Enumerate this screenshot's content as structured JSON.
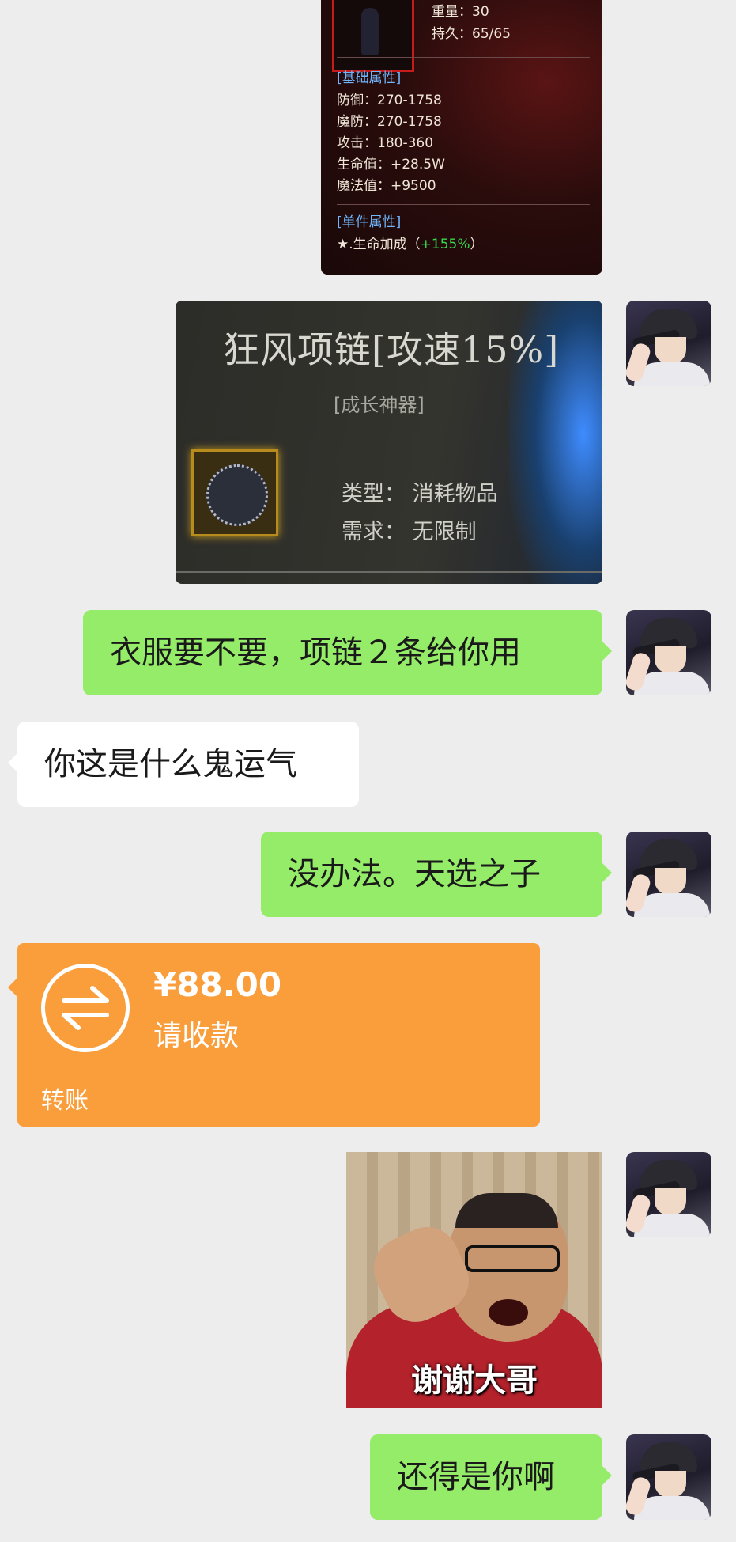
{
  "card1": {
    "weight": "重量：30",
    "durability": "持久：65/65",
    "base_title": "[基础属性]",
    "defense": "防御：270-1758",
    "magic_defense": "魔防：270-1758",
    "attack": "攻击：180-360",
    "hp": "生命值：+28.5W",
    "mp": "魔法值：+9500",
    "single_title": "[单件属性]",
    "bonus_prefix": "★.生命加成（",
    "bonus_value": "+155%",
    "bonus_suffix": "）"
  },
  "card2": {
    "title": "狂风项链[攻速15%]",
    "subtitle": "[成长神器]",
    "type": "类型： 消耗物品",
    "require": "需求： 无限制"
  },
  "messages": {
    "m1": "衣服要不要，项链２条给你用",
    "m2": "你这是什么鬼运气",
    "m3": "没办法。天选之子",
    "m4": "还得是你啊"
  },
  "transfer": {
    "amount": "¥88.00",
    "status": "请收款",
    "type": "转账"
  },
  "meme": {
    "caption": "谢谢大哥"
  },
  "colors": {
    "background": "#ededed",
    "my_bubble": "#95ec69",
    "other_bubble": "#ffffff",
    "transfer": "#fa9d3b"
  }
}
